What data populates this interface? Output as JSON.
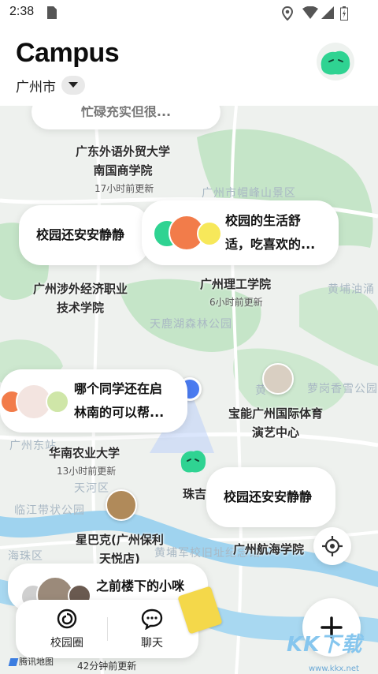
{
  "status": {
    "time": "2:38"
  },
  "header": {
    "title": "Campus",
    "city": "广州市"
  },
  "map": {
    "places": [
      {
        "name": "广东外语外贸大学\n南国商学院",
        "updated": "17小时前更新"
      },
      {
        "name": "广州涉外经济职业\n技术学院"
      },
      {
        "name": "广州理工学院",
        "updated": "6小时前更新"
      },
      {
        "name": "宝能广州国际体育\n演艺中心"
      },
      {
        "name": "华南农业大学",
        "updated": "13小时前更新"
      },
      {
        "name": "珠吉"
      },
      {
        "name": "星巴克(广州保利\n天悦店)"
      },
      {
        "name": "广州航海学院"
      }
    ],
    "faint_labels": [
      "广州市帽峰山景区",
      "黄埔油涌",
      "天鹿湖森林公园",
      "萝岗香雪公园",
      "广州东站",
      "天河区",
      "临江带状公园",
      "海珠区",
      "黄埔军校旧址纪念馆",
      "黄"
    ],
    "bottom_updated": "42分钟前更新",
    "attribution": "腾讯地图"
  },
  "bubbles": {
    "top_partial": "忙碌充实但很...",
    "b1": "校园还安安静静",
    "b2": "校园的生活舒\n适，吃喜欢的...",
    "b3": "哪个同学还在启\n林南的可以帮...",
    "b4": "校园还安安静静",
    "b5": "之前楼下的小咪"
  },
  "nav": {
    "tab1": "校园圈",
    "tab2": "聊天"
  },
  "watermark": {
    "main": "KK下载",
    "sub": "www.kkx.net"
  },
  "colors": {
    "accent_green": "#2fd392",
    "pin_blue": "#4a7bf0",
    "water": "#9fd3ef",
    "park": "#bfe3c3"
  }
}
